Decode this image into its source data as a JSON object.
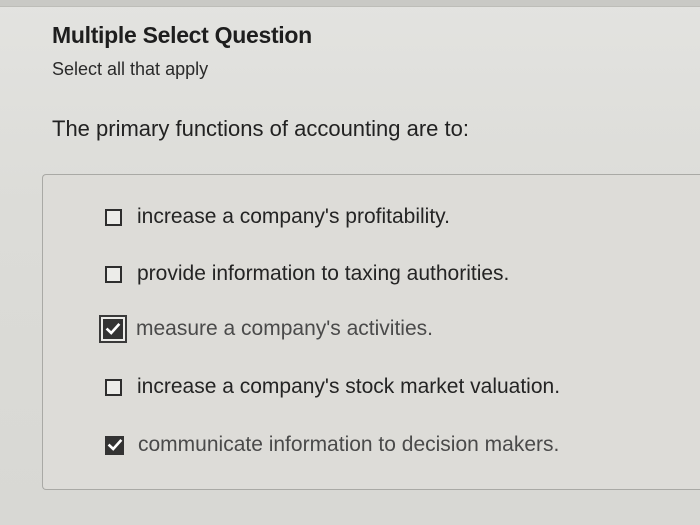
{
  "question": {
    "type_label": "Multiple Select Question",
    "instruction": "Select all that apply",
    "prompt": "The primary functions of accounting are to:"
  },
  "options": [
    {
      "label": "increase a company's profitability.",
      "checked": false
    },
    {
      "label": "provide information to taxing authorities.",
      "checked": false
    },
    {
      "label": "measure a company's activities.",
      "checked": true
    },
    {
      "label": "increase a company's stock market valuation.",
      "checked": false
    },
    {
      "label": "communicate information to decision makers.",
      "checked": true
    }
  ],
  "icons": {
    "checkbox_unchecked": "checkbox-empty-icon",
    "checkbox_checked": "checkmark-icon"
  },
  "colors": {
    "background": "#dcdcd8",
    "text": "#1f1f1f",
    "checkbox_fill": "#333333"
  }
}
